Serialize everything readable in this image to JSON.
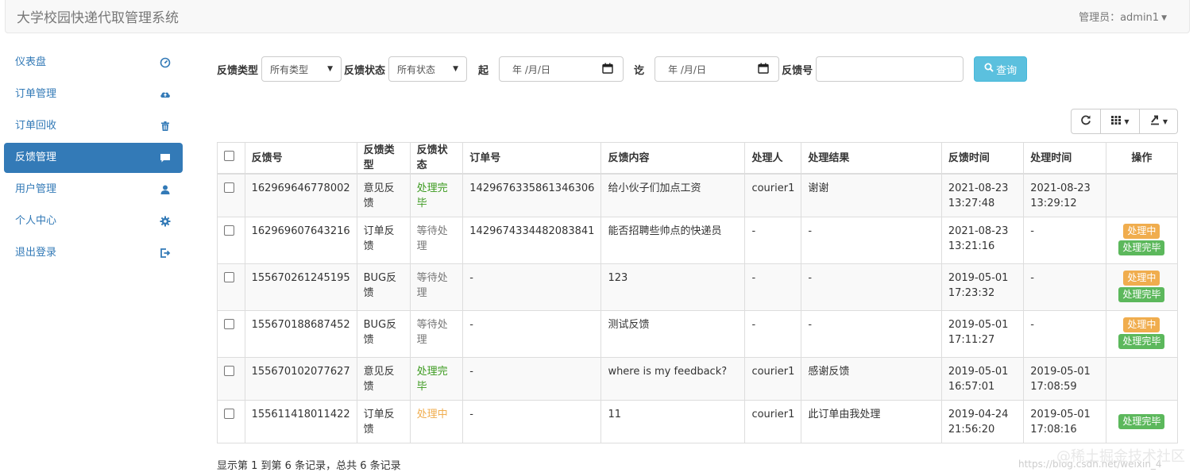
{
  "header": {
    "title": "大学校园快递代取管理系统",
    "admin_label": "管理员：admin1"
  },
  "sidebar": {
    "items": [
      {
        "label": "仪表盘",
        "icon": "dashboard-icon"
      },
      {
        "label": "订单管理",
        "icon": "cloud-icon"
      },
      {
        "label": "订单回收",
        "icon": "trash-icon"
      },
      {
        "label": "反馈管理",
        "icon": "comment-icon",
        "active": true
      },
      {
        "label": "用户管理",
        "icon": "user-icon"
      },
      {
        "label": "个人中心",
        "icon": "gear-icon"
      },
      {
        "label": "退出登录",
        "icon": "logout-icon"
      }
    ]
  },
  "filters": {
    "type_label": "反馈类型",
    "type_value": "所有类型",
    "status_label": "反馈状态",
    "status_value": "所有状态",
    "from_label": "起",
    "from_placeholder": "年 /月/日",
    "to_label": "讫",
    "to_placeholder": "年 /月/日",
    "id_label": "反馈号",
    "id_value": "",
    "search_label": "查询"
  },
  "table": {
    "columns": [
      "反馈号",
      "反馈类型",
      "反馈状态",
      "订单号",
      "反馈内容",
      "处理人",
      "处理结果",
      "反馈时间",
      "处理时间",
      "操作"
    ],
    "rows": [
      {
        "id": "162969646778002",
        "type": "意见反馈",
        "status": "处理完毕",
        "status_kind": "done",
        "order": "1429676335861346306",
        "content": "给小伙子们加点工资",
        "handler": "courier1",
        "result": "谢谢",
        "fb_date": "2021-08-23",
        "fb_time": "13:27:48",
        "proc_date": "2021-08-23",
        "proc_time": "13:29:12",
        "ops": []
      },
      {
        "id": "162969607643216",
        "type": "订单反馈",
        "status": "等待处理",
        "status_kind": "wait",
        "order": "1429674334482083841",
        "content": "能否招聘些帅点的快递员",
        "handler": "-",
        "result": "-",
        "fb_date": "2021-08-23",
        "fb_time": "13:21:16",
        "proc_date": "-",
        "proc_time": "",
        "ops": [
          "处理中",
          "处理完毕"
        ]
      },
      {
        "id": "155670261245195",
        "type": "BUG反馈",
        "status": "等待处理",
        "status_kind": "wait",
        "order": "-",
        "content": "123",
        "handler": "-",
        "result": "-",
        "fb_date": "2019-05-01",
        "fb_time": "17:23:32",
        "proc_date": "-",
        "proc_time": "",
        "ops": [
          "处理中",
          "处理完毕"
        ]
      },
      {
        "id": "155670188687452",
        "type": "BUG反馈",
        "status": "等待处理",
        "status_kind": "wait",
        "order": "-",
        "content": "测试反馈",
        "handler": "-",
        "result": "-",
        "fb_date": "2019-05-01",
        "fb_time": "17:11:27",
        "proc_date": "-",
        "proc_time": "",
        "ops": [
          "处理中",
          "处理完毕"
        ]
      },
      {
        "id": "155670102077627",
        "type": "意见反馈",
        "status": "处理完毕",
        "status_kind": "done",
        "order": "-",
        "content": "where is my feedback?",
        "handler": "courier1",
        "result": "感谢反馈",
        "fb_date": "2019-05-01",
        "fb_time": "16:57:01",
        "proc_date": "2019-05-01",
        "proc_time": "17:08:59",
        "ops": []
      },
      {
        "id": "155611418011422",
        "type": "订单反馈",
        "status": "处理中",
        "status_kind": "proc",
        "order": "-",
        "content": "11",
        "handler": "courier1",
        "result": "此订单由我处理",
        "fb_date": "2019-04-24",
        "fb_time": "21:56:20",
        "proc_date": "2019-05-01",
        "proc_time": "17:08:16",
        "ops": [
          "处理完毕"
        ]
      }
    ]
  },
  "summary": "显示第 1 到第 6 条记录，总共 6 条记录",
  "watermark": {
    "url": "https://blog.csdn.net/weixin_4",
    "site": "@稀土掘金技术社区"
  },
  "colors": {
    "primary": "#337ab7",
    "info": "#5bc0de",
    "success": "#5cb85c",
    "warning": "#f0ad4e",
    "done_text": "#3c9a1f"
  }
}
